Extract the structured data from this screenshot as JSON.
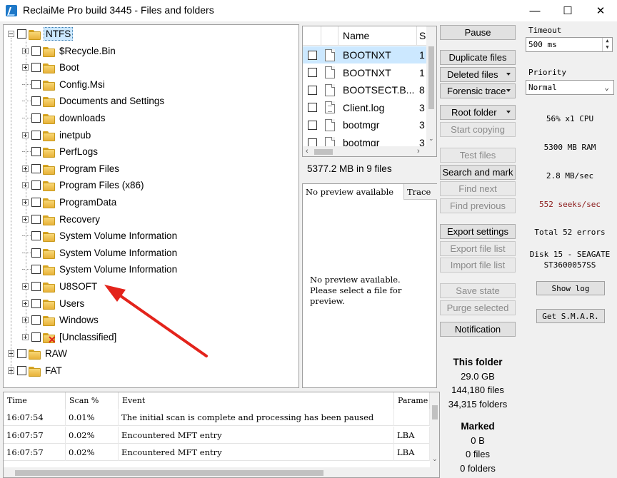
{
  "window": {
    "title": "ReclaiMe Pro build 3445 - Files and folders",
    "minimize_glyph": "—",
    "maximize_glyph": "☐",
    "close_glyph": "✕"
  },
  "tree": {
    "items": [
      {
        "label": "NTFS",
        "level": 0,
        "expander": "minus",
        "selected": true
      },
      {
        "label": "$Recycle.Bin",
        "level": 1,
        "expander": "plus"
      },
      {
        "label": "Boot",
        "level": 1,
        "expander": "plus"
      },
      {
        "label": "Config.Msi",
        "level": 1,
        "expander": "none"
      },
      {
        "label": "Documents and Settings",
        "level": 1,
        "expander": "none"
      },
      {
        "label": "downloads",
        "level": 1,
        "expander": "none"
      },
      {
        "label": "inetpub",
        "level": 1,
        "expander": "plus"
      },
      {
        "label": "PerfLogs",
        "level": 1,
        "expander": "none"
      },
      {
        "label": "Program Files",
        "level": 1,
        "expander": "plus"
      },
      {
        "label": "Program Files (x86)",
        "level": 1,
        "expander": "plus"
      },
      {
        "label": "ProgramData",
        "level": 1,
        "expander": "plus"
      },
      {
        "label": "Recovery",
        "level": 1,
        "expander": "plus"
      },
      {
        "label": "System Volume Information",
        "level": 1,
        "expander": "none"
      },
      {
        "label": "System Volume Information",
        "level": 1,
        "expander": "none"
      },
      {
        "label": "System Volume Information",
        "level": 1,
        "expander": "none"
      },
      {
        "label": "U8SOFT",
        "level": 1,
        "expander": "plus"
      },
      {
        "label": "Users",
        "level": 1,
        "expander": "plus"
      },
      {
        "label": "Windows",
        "level": 1,
        "expander": "plus"
      },
      {
        "label": "[Unclassified]",
        "level": 1,
        "expander": "plus",
        "unclassified": true
      },
      {
        "label": "RAW",
        "level": 0,
        "expander": "plus"
      },
      {
        "label": "FAT",
        "level": 0,
        "expander": "plus"
      }
    ]
  },
  "filelist": {
    "columns": [
      "Name",
      "S"
    ],
    "rows": [
      {
        "name": "BOOTNXT",
        "size": "1",
        "selected": true,
        "icon": "file-icon"
      },
      {
        "name": "BOOTNXT",
        "size": "1",
        "icon": "file-icon"
      },
      {
        "name": "BOOTSECT.B...",
        "size": "8",
        "icon": "file-icon"
      },
      {
        "name": "Client.log",
        "size": "3",
        "icon": "text-file-icon"
      },
      {
        "name": "bootmgr",
        "size": "3",
        "icon": "file-icon"
      },
      {
        "name": "bootmgr",
        "size": "3",
        "icon": "file-icon"
      }
    ],
    "summary": "5377.2 MB in 9 files"
  },
  "preview": {
    "tabs": [
      "No preview available",
      "Trace"
    ],
    "message": "No preview available.\nPlease select a file for\npreview."
  },
  "buttons": {
    "pause": "Pause",
    "duplicate_files": "Duplicate files",
    "deleted_files": "Deleted files",
    "forensic_trace": "Forensic trace",
    "root_folder": "Root folder",
    "start_copying": "Start copying",
    "test_files": "Test files",
    "search_and_mark": "Search and mark",
    "find_next": "Find next",
    "find_previous": "Find previous",
    "export_settings": "Export settings",
    "export_file_list": "Export file list",
    "import_file_list": "Import file list",
    "save_state": "Save state",
    "purge_selected": "Purge selected",
    "notification": "Notification"
  },
  "folder_info": {
    "this_folder_title": "This folder",
    "size": "29.0 GB",
    "files": "144,180 files",
    "folders": "34,315 folders",
    "marked_title": "Marked",
    "marked_size": "0 B",
    "marked_files": "0 files",
    "marked_folders": "0 folders"
  },
  "stats": {
    "timeout_label": "Timeout",
    "timeout_value": "500 ms",
    "priority_label": "Priority",
    "priority_value": "Normal",
    "cpu": "56% x1 CPU",
    "ram": "5300 MB RAM",
    "speed": "2.8 MB/sec",
    "seeks": "552 seeks/sec",
    "errors": "Total 52 errors",
    "disk_line1": "Disk 15 - SEAGATE",
    "disk_line2": "ST3600057SS",
    "show_log": "Show log",
    "get_smart": "Get S.M.A.R."
  },
  "log": {
    "columns": [
      "Time",
      "Scan %",
      "Event",
      "Parame"
    ],
    "rows": [
      {
        "time": "16:07:54",
        "scan": "0.01%",
        "event": "The initial scan is complete and processing has been paused",
        "param": ""
      },
      {
        "time": "16:07:57",
        "scan": "0.02%",
        "event": "Encountered MFT entry",
        "param": "LBA"
      },
      {
        "time": "16:07:57",
        "scan": "0.02%",
        "event": "Encountered MFT entry",
        "param": "LBA"
      }
    ]
  },
  "colors": {
    "selection": "#cce8ff",
    "seeks_text": "#8b1a1a",
    "arrow": "#e3231b"
  }
}
